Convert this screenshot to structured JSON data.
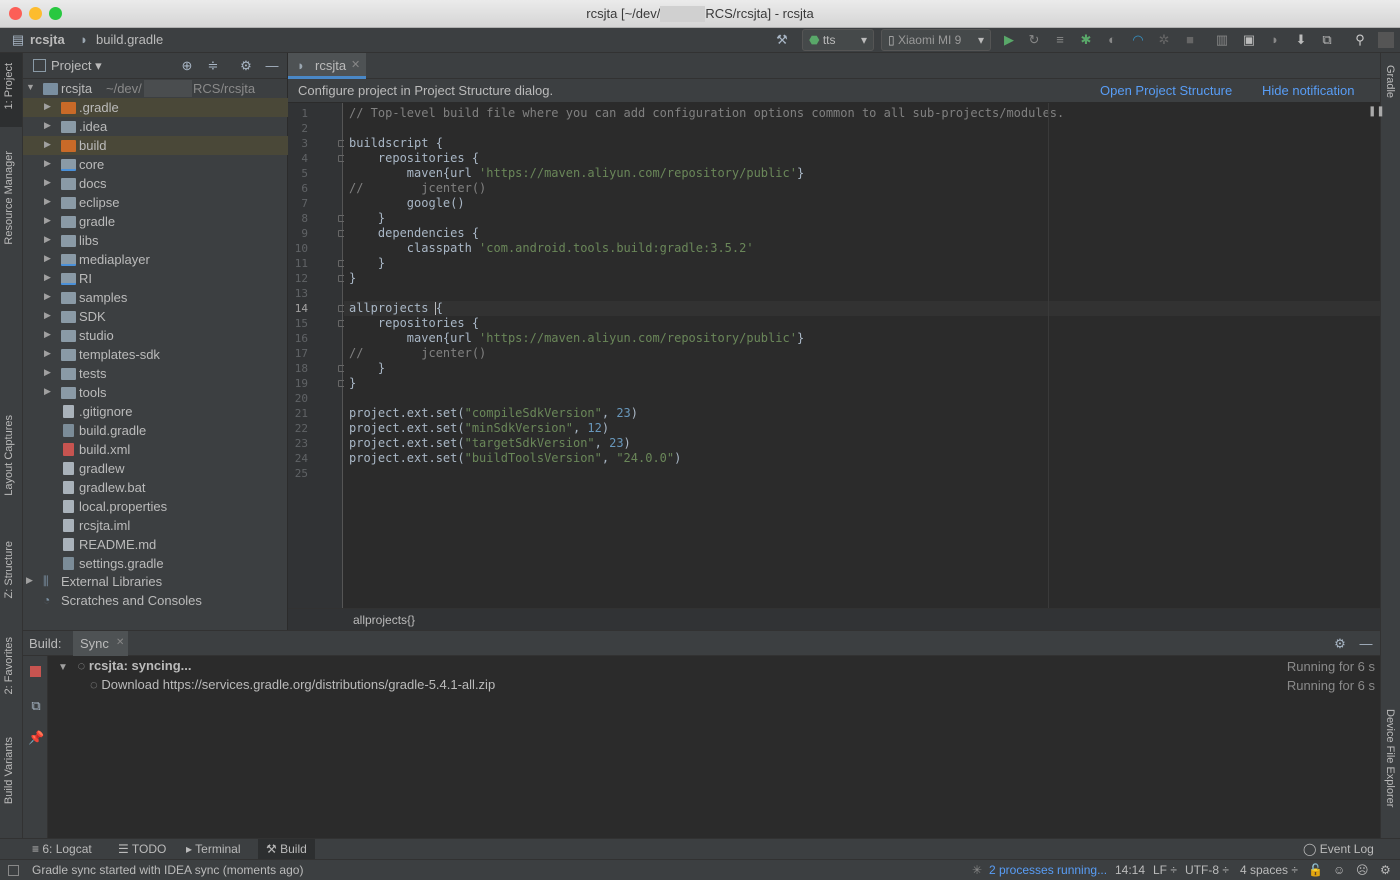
{
  "window": {
    "title_left": "rcsjta [~/dev/",
    "title_right": "RCS/rcsjta] - rcsjta"
  },
  "navbar": {
    "project": "rcsjta",
    "file": "build.gradle",
    "run_config": "tts",
    "device": "Xiaomi MI 9"
  },
  "left_stripe": {
    "project_tab": "1: Project",
    "resource_manager_tab": "Resource Manager",
    "layout_captures_tab": "Layout Captures",
    "structure_tab": "Z: Structure",
    "favorites_tab": "2: Favorites",
    "build_variants_tab": "Build Variants"
  },
  "right_stripe": {
    "gradle_tab": "Gradle",
    "device_file_explorer_tab": "Device File Explorer"
  },
  "project_panel": {
    "view_selector": "Project",
    "root_name": "rcsjta",
    "root_path_prefix": "~/dev/",
    "root_path_suffix": "RCS/rcsjta",
    "items": [
      {
        "label": ".gradle",
        "kind": "folder",
        "color": "orange",
        "expandable": true,
        "selected": true
      },
      {
        "label": ".idea",
        "kind": "folder",
        "color": "grey",
        "expandable": true,
        "selected": false
      },
      {
        "label": "build",
        "kind": "folder",
        "color": "orange",
        "expandable": true,
        "selected": true
      },
      {
        "label": "core",
        "kind": "module",
        "color": "grey",
        "expandable": true,
        "selected": false
      },
      {
        "label": "docs",
        "kind": "folder",
        "color": "grey",
        "expandable": true,
        "selected": false
      },
      {
        "label": "eclipse",
        "kind": "folder",
        "color": "grey",
        "expandable": true,
        "selected": false
      },
      {
        "label": "gradle",
        "kind": "folder",
        "color": "grey",
        "expandable": true,
        "selected": false
      },
      {
        "label": "libs",
        "kind": "folder",
        "color": "grey",
        "expandable": true,
        "selected": false
      },
      {
        "label": "mediaplayer",
        "kind": "module",
        "color": "grey",
        "expandable": true,
        "selected": false
      },
      {
        "label": "RI",
        "kind": "module",
        "color": "grey",
        "expandable": true,
        "selected": false
      },
      {
        "label": "samples",
        "kind": "folder",
        "color": "grey",
        "expandable": true,
        "selected": false
      },
      {
        "label": "SDK",
        "kind": "folder",
        "color": "grey",
        "expandable": true,
        "selected": false
      },
      {
        "label": "studio",
        "kind": "folder",
        "color": "grey",
        "expandable": true,
        "selected": false
      },
      {
        "label": "templates-sdk",
        "kind": "folder",
        "color": "grey",
        "expandable": true,
        "selected": false
      },
      {
        "label": "tests",
        "kind": "folder",
        "color": "grey",
        "expandable": true,
        "selected": false
      },
      {
        "label": "tools",
        "kind": "folder",
        "color": "grey",
        "expandable": true,
        "selected": false
      },
      {
        "label": ".gitignore",
        "kind": "file",
        "expandable": false,
        "selected": false
      },
      {
        "label": "build.gradle",
        "kind": "gradle-file",
        "expandable": false,
        "selected": false
      },
      {
        "label": "build.xml",
        "kind": "xml-file",
        "expandable": false,
        "selected": false
      },
      {
        "label": "gradlew",
        "kind": "file",
        "expandable": false,
        "selected": false
      },
      {
        "label": "gradlew.bat",
        "kind": "file",
        "expandable": false,
        "selected": false
      },
      {
        "label": "local.properties",
        "kind": "file",
        "expandable": false,
        "selected": false
      },
      {
        "label": "rcsjta.iml",
        "kind": "file",
        "expandable": false,
        "selected": false
      },
      {
        "label": "README.md",
        "kind": "file",
        "expandable": false,
        "selected": false
      },
      {
        "label": "settings.gradle",
        "kind": "gradle-file",
        "expandable": false,
        "selected": false
      }
    ],
    "external_libraries": "External Libraries",
    "scratches": "Scratches and Consoles"
  },
  "editor": {
    "tab_label": "rcsjta",
    "notification_text": "Configure project in Project Structure dialog.",
    "notification_action_1": "Open Project Structure",
    "notification_action_2": "Hide notification",
    "current_line": 14,
    "breadcrumb": "allprojects{}",
    "lines": [
      [
        {
          "t": "// Top-level build file where you can add configuration options common to all sub-projects/modules.",
          "c": "com"
        }
      ],
      [],
      [
        {
          "t": "buildscript {",
          "c": ""
        }
      ],
      [
        {
          "t": "    repositories {",
          "c": ""
        }
      ],
      [
        {
          "t": "        maven{url ",
          "c": ""
        },
        {
          "t": "'https://maven.aliyun.com/repository/public'",
          "c": "str"
        },
        {
          "t": "}",
          "c": ""
        }
      ],
      [
        {
          "t": "//        jcenter()",
          "c": "com"
        }
      ],
      [
        {
          "t": "        google()",
          "c": ""
        }
      ],
      [
        {
          "t": "    }",
          "c": ""
        }
      ],
      [
        {
          "t": "    dependencies {",
          "c": ""
        }
      ],
      [
        {
          "t": "        classpath ",
          "c": ""
        },
        {
          "t": "'com.android.tools.build:gradle:3.5.2'",
          "c": "str"
        }
      ],
      [
        {
          "t": "    }",
          "c": ""
        }
      ],
      [
        {
          "t": "}",
          "c": ""
        }
      ],
      [],
      [
        {
          "t": "allprojects {",
          "c": ""
        }
      ],
      [
        {
          "t": "    repositories {",
          "c": ""
        }
      ],
      [
        {
          "t": "        maven{url ",
          "c": ""
        },
        {
          "t": "'https://maven.aliyun.com/repository/public'",
          "c": "str"
        },
        {
          "t": "}",
          "c": ""
        }
      ],
      [
        {
          "t": "//        jcenter()",
          "c": "com"
        }
      ],
      [
        {
          "t": "    }",
          "c": ""
        }
      ],
      [
        {
          "t": "}",
          "c": ""
        }
      ],
      [],
      [
        {
          "t": "project.ext.set(",
          "c": ""
        },
        {
          "t": "\"compileSdkVersion\"",
          "c": "str"
        },
        {
          "t": ", ",
          "c": ""
        },
        {
          "t": "23",
          "c": "num"
        },
        {
          "t": ")",
          "c": ""
        }
      ],
      [
        {
          "t": "project.ext.set(",
          "c": ""
        },
        {
          "t": "\"minSdkVersion\"",
          "c": "str"
        },
        {
          "t": ", ",
          "c": ""
        },
        {
          "t": "12",
          "c": "num"
        },
        {
          "t": ")",
          "c": ""
        }
      ],
      [
        {
          "t": "project.ext.set(",
          "c": ""
        },
        {
          "t": "\"targetSdkVersion\"",
          "c": "str"
        },
        {
          "t": ", ",
          "c": ""
        },
        {
          "t": "23",
          "c": "num"
        },
        {
          "t": ")",
          "c": ""
        }
      ],
      [
        {
          "t": "project.ext.set(",
          "c": ""
        },
        {
          "t": "\"buildToolsVersion\"",
          "c": "str"
        },
        {
          "t": ", ",
          "c": ""
        },
        {
          "t": "\"24.0.0\"",
          "c": "str"
        },
        {
          "t": ")",
          "c": ""
        }
      ],
      []
    ]
  },
  "build_panel": {
    "title": "Build:",
    "tab": "Sync",
    "row1_label": "rcsjta: syncing...",
    "row1_status": "Running for 6 s",
    "row2_label": "Download https://services.gradle.org/distributions/gradle-5.4.1-all.zip",
    "row2_status": "Running for 6 s"
  },
  "bottom_tabs": {
    "logcat": "6: Logcat",
    "todo": "TODO",
    "terminal": "Terminal",
    "build": "Build",
    "event_log": "Event Log"
  },
  "status_bar": {
    "message": "Gradle sync started with IDEA sync (moments ago)",
    "processes": "2 processes running...",
    "position": "14:14",
    "line_sep": "LF ÷",
    "encoding": "UTF-8 ÷",
    "indent": "4 spaces ÷"
  },
  "colors": {
    "accent_link": "#589df6",
    "run_green": "#59a869",
    "stop_red": "#c75450"
  }
}
